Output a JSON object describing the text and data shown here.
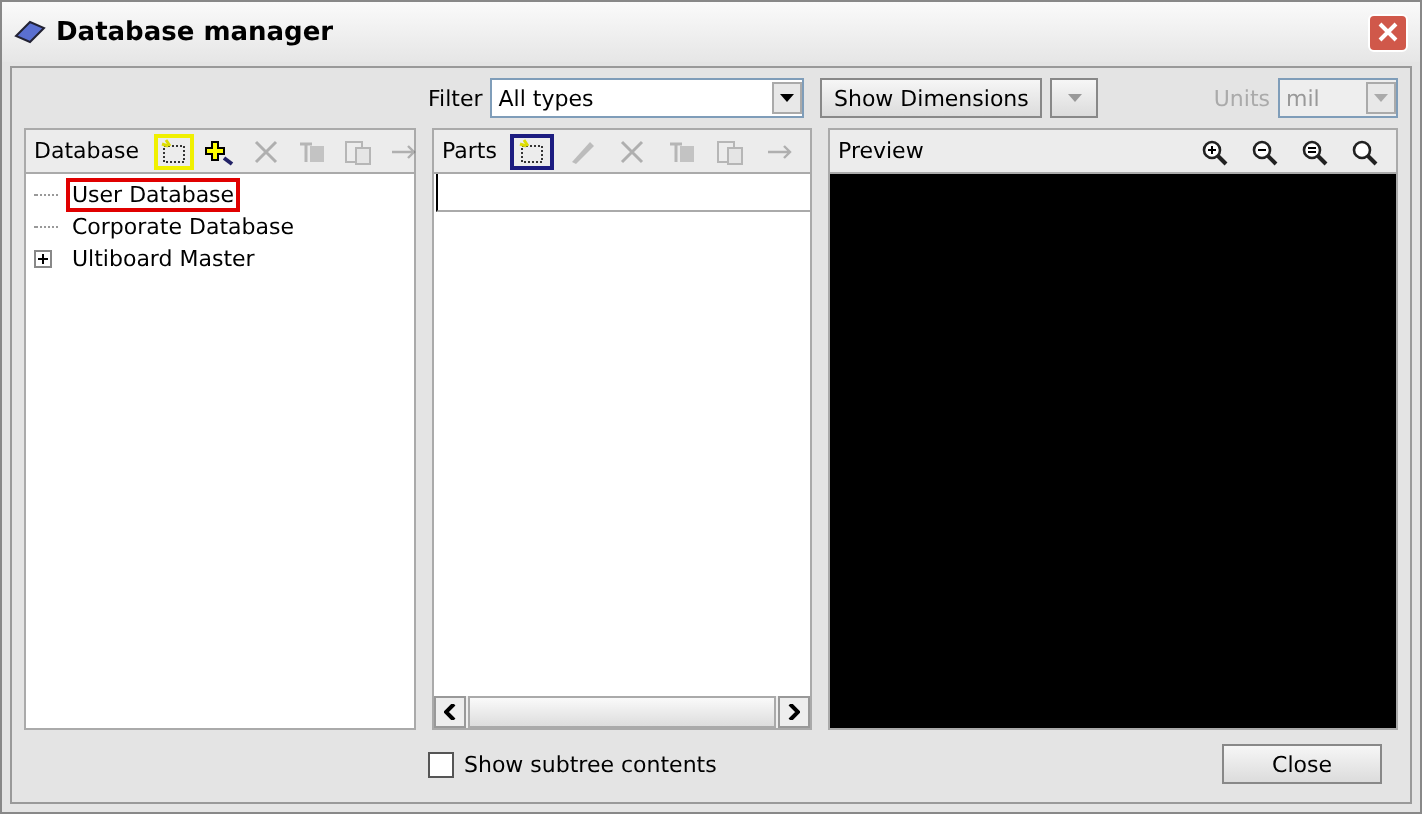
{
  "window": {
    "title": "Database manager"
  },
  "filter": {
    "label": "Filter",
    "value": "All types"
  },
  "show_dimensions": {
    "label": "Show Dimensions"
  },
  "units": {
    "label": "Units",
    "value": "mil",
    "disabled": true
  },
  "database_panel": {
    "title": "Database",
    "tools": [
      {
        "kind": "new",
        "disabled": false,
        "color": "#f0f000"
      },
      {
        "kind": "find",
        "disabled": false
      },
      {
        "kind": "delete",
        "disabled": true
      },
      {
        "kind": "rename",
        "disabled": true
      },
      {
        "kind": "copy",
        "disabled": true
      },
      {
        "kind": "move",
        "disabled": true
      }
    ],
    "tree": [
      {
        "label": "User Database",
        "selected": true
      },
      {
        "label": "Corporate Database",
        "selected": false
      },
      {
        "label": "Ultiboard Master",
        "selected": false,
        "expanded": false
      }
    ]
  },
  "parts_panel": {
    "title": "Parts",
    "tools": [
      {
        "kind": "new",
        "disabled": false,
        "color": "#1c1c80"
      },
      {
        "kind": "edit",
        "disabled": true
      },
      {
        "kind": "delete",
        "disabled": true
      },
      {
        "kind": "rename",
        "disabled": true
      },
      {
        "kind": "copy",
        "disabled": true
      },
      {
        "kind": "move",
        "disabled": true
      }
    ]
  },
  "preview_panel": {
    "title": "Preview",
    "tools": [
      {
        "kind": "zoom-in"
      },
      {
        "kind": "zoom-out"
      },
      {
        "kind": "zoom-window"
      },
      {
        "kind": "zoom-fit"
      }
    ]
  },
  "show_subtree": {
    "label": "Show subtree contents",
    "checked": false
  },
  "close_button": {
    "label": "Close"
  }
}
